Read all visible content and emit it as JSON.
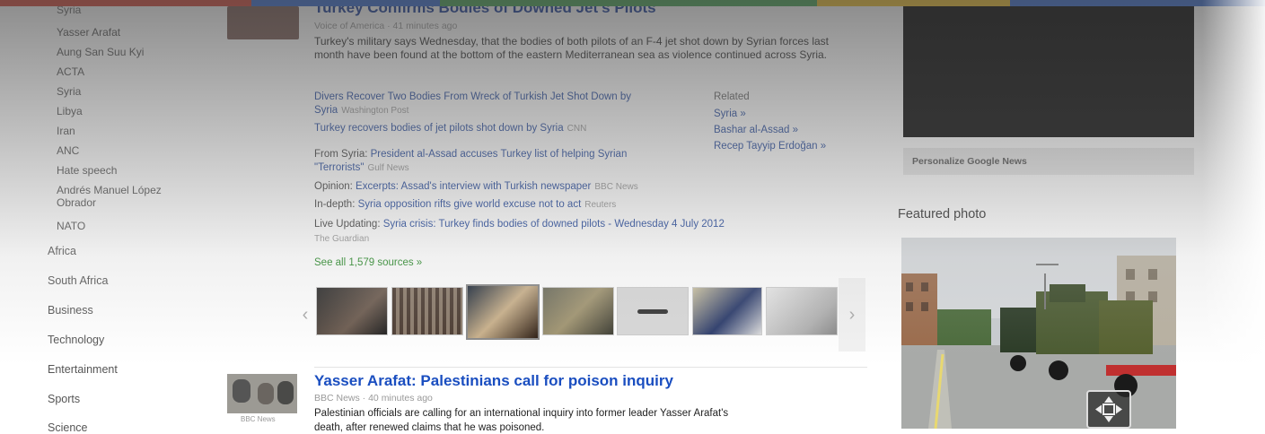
{
  "left_nav": {
    "truncated_top": "Syria",
    "sub_items": [
      "Yasser Arafat",
      "Aung San Suu Kyi",
      "ACTA",
      "Syria",
      "Libya",
      "Iran",
      "ANC",
      "Hate speech",
      "Andrés Manuel López Obrador",
      "NATO"
    ],
    "sections": [
      "Africa",
      "South Africa",
      "Business",
      "Technology",
      "Entertainment",
      "Sports",
      "Science"
    ]
  },
  "story1": {
    "headline": "Turkey Confirms Bodies of Downed Jet's Pilots",
    "meta": "Voice of America · 41 minutes ago",
    "snippet": "Turkey's military says Wednesday, that the bodies of both pilots of an F-4 jet shot down by Syrian forces last month have been found at the bottom of the eastern Mediterranean sea as violence continued across Syria.",
    "related": [
      {
        "text": "Divers Recover Two Bodies From Wreck of Turkish Jet Shot Down by Syria",
        "source": "Washington Post"
      },
      {
        "text": "Turkey recovers bodies of jet pilots shot down by Syria",
        "source": "CNN"
      },
      {
        "label": "From Syria:",
        "text": "President al-Assad accuses Turkey list of helping Syrian \"Terrorists\"",
        "source": "Gulf News"
      },
      {
        "label": "Opinion:",
        "text": "Excerpts: Assad's interview with Turkish newspaper",
        "source": "BBC News"
      },
      {
        "label": "In-depth:",
        "text": "Syria opposition rifts give world excuse not to act",
        "source": "Reuters"
      },
      {
        "label": "Live Updating:",
        "text": "Syria crisis: Turkey finds bodies of downed pilots - Wednesday 4 July 2012",
        "source": "The Guardian"
      }
    ],
    "topics": [
      "Related",
      "Syria »",
      "Bashar al-Assad »",
      "Recep Tayyip Erdoğan »"
    ],
    "see_all": "See all 1,579 sources »",
    "carousel_prev": "‹",
    "carousel_next": "›"
  },
  "story2": {
    "headline": "Yasser Arafat: Palestinians call for poison inquiry",
    "meta": "BBC News · 40 minutes ago",
    "snippet": "Palestinian officials are calling for an international inquiry into former leader Yasser Arafat's",
    "snippet2": "death, after renewed claims that he was poisoned.",
    "thumb_caption": "BBC News"
  },
  "right": {
    "personalize": "Personalize Google News",
    "featured_title": "Featured photo"
  },
  "colors": {
    "bar": [
      "#d84a3c",
      "#3b6fd4",
      "#4aa657",
      "#f2c230",
      "#3b6fd4"
    ]
  }
}
